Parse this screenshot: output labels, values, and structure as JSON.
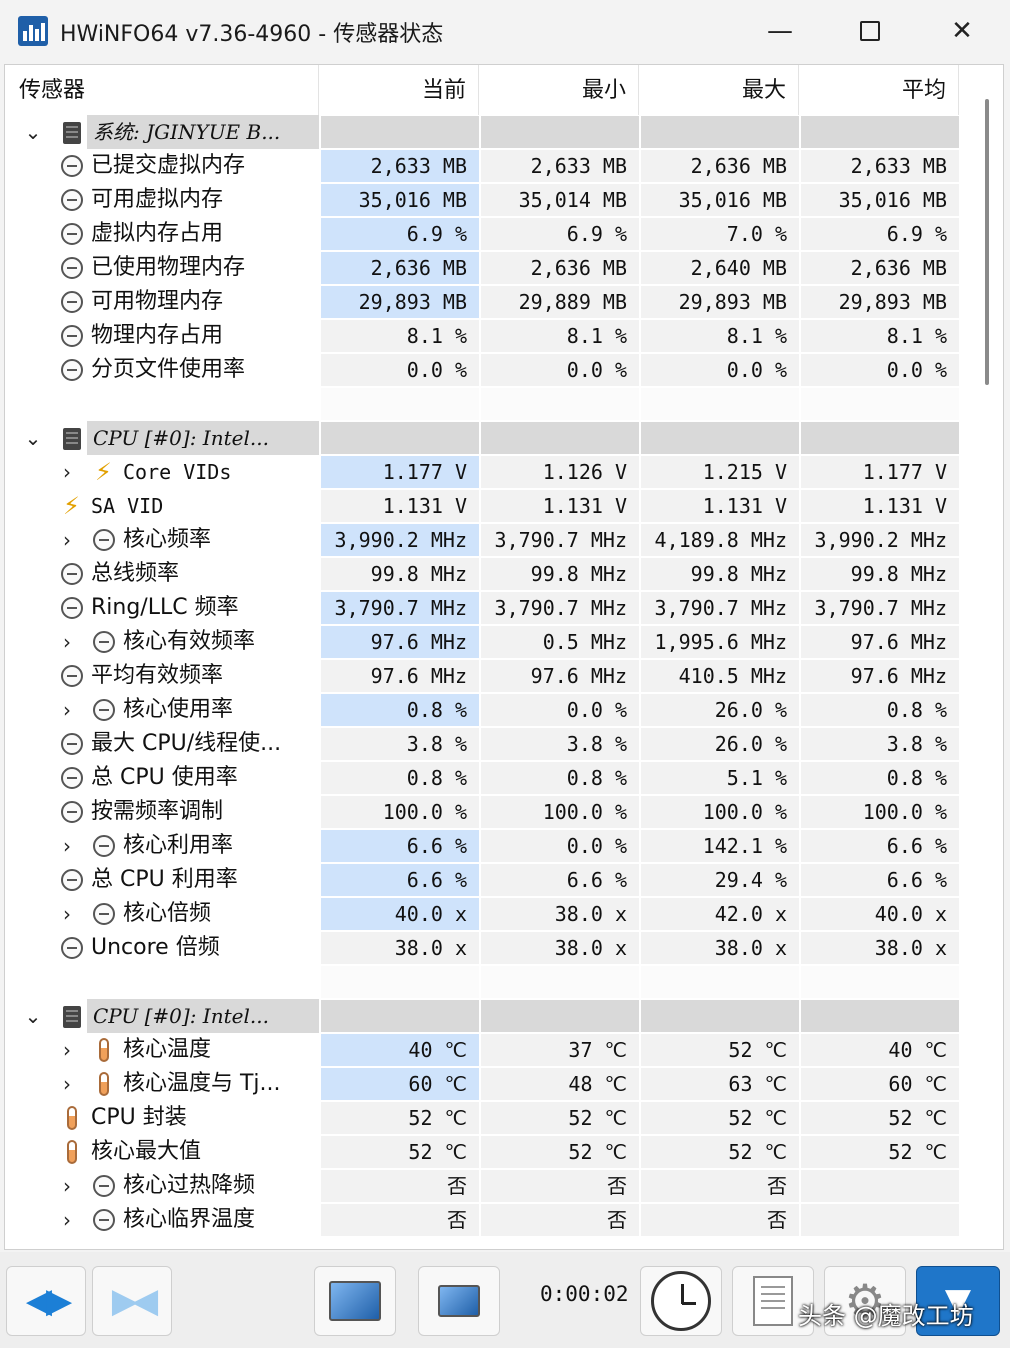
{
  "window": {
    "title": "HWiNFO64 v7.36-4960 - 传感器状态",
    "min_glyph": "—",
    "close_glyph": "✕"
  },
  "columns": {
    "sensor": "传感器",
    "current": "当前",
    "min": "最小",
    "max": "最大",
    "avg": "平均"
  },
  "rows": [
    {
      "type": "group",
      "label": "系统: JGINYUE B..."
    },
    {
      "type": "item",
      "label": "已提交虚拟内存",
      "icon": "clock-icon",
      "hl": true,
      "v": [
        "2,633 MB",
        "2,633 MB",
        "2,636 MB",
        "2,633 MB"
      ]
    },
    {
      "type": "item",
      "label": "可用虚拟内存",
      "icon": "clock-icon",
      "hl": true,
      "v": [
        "35,016 MB",
        "35,014 MB",
        "35,016 MB",
        "35,016 MB"
      ]
    },
    {
      "type": "item",
      "label": "虚拟内存占用",
      "icon": "clock-icon",
      "hl": true,
      "v": [
        "6.9 %",
        "6.9 %",
        "7.0 %",
        "6.9 %"
      ]
    },
    {
      "type": "item",
      "label": "已使用物理内存",
      "icon": "clock-icon",
      "hl": true,
      "v": [
        "2,636 MB",
        "2,636 MB",
        "2,640 MB",
        "2,636 MB"
      ]
    },
    {
      "type": "item",
      "label": "可用物理内存",
      "icon": "clock-icon",
      "hl": true,
      "v": [
        "29,893 MB",
        "29,889 MB",
        "29,893 MB",
        "29,893 MB"
      ]
    },
    {
      "type": "item",
      "label": "物理内存占用",
      "icon": "clock-icon",
      "hl": false,
      "v": [
        "8.1 %",
        "8.1 %",
        "8.1 %",
        "8.1 %"
      ]
    },
    {
      "type": "item",
      "label": "分页文件使用率",
      "icon": "clock-icon",
      "hl": false,
      "v": [
        "0.0 %",
        "0.0 %",
        "0.0 %",
        "0.0 %"
      ]
    },
    {
      "type": "spacer"
    },
    {
      "type": "group",
      "label": "CPU [#0]: Intel..."
    },
    {
      "type": "item",
      "label": "Core VIDs",
      "icon": "bolt-icon",
      "expand": true,
      "hl": true,
      "mono": true,
      "v": [
        "1.177 V",
        "1.126 V",
        "1.215 V",
        "1.177 V"
      ]
    },
    {
      "type": "item",
      "label": "SA VID",
      "icon": "bolt-icon",
      "hl": false,
      "mono": true,
      "v": [
        "1.131 V",
        "1.131 V",
        "1.131 V",
        "1.131 V"
      ]
    },
    {
      "type": "item",
      "label": "核心频率",
      "icon": "clock-icon",
      "expand": true,
      "hl": true,
      "v": [
        "3,990.2 MHz",
        "3,790.7 MHz",
        "4,189.8 MHz",
        "3,990.2 MHz"
      ]
    },
    {
      "type": "item",
      "label": "总线频率",
      "icon": "clock-icon",
      "hl": false,
      "v": [
        "99.8 MHz",
        "99.8 MHz",
        "99.8 MHz",
        "99.8 MHz"
      ]
    },
    {
      "type": "item",
      "label": "Ring/LLC 频率",
      "icon": "clock-icon",
      "hl": true,
      "v": [
        "3,790.7 MHz",
        "3,790.7 MHz",
        "3,790.7 MHz",
        "3,790.7 MHz"
      ]
    },
    {
      "type": "item",
      "label": "核心有效频率",
      "icon": "clock-icon",
      "expand": true,
      "hl": true,
      "v": [
        "97.6 MHz",
        "0.5 MHz",
        "1,995.6 MHz",
        "97.6 MHz"
      ]
    },
    {
      "type": "item",
      "label": "平均有效频率",
      "icon": "clock-icon",
      "hl": false,
      "v": [
        "97.6 MHz",
        "97.6 MHz",
        "410.5 MHz",
        "97.6 MHz"
      ]
    },
    {
      "type": "item",
      "label": "核心使用率",
      "icon": "clock-icon",
      "expand": true,
      "hl": true,
      "v": [
        "0.8 %",
        "0.0 %",
        "26.0 %",
        "0.8 %"
      ]
    },
    {
      "type": "item",
      "label": "最大 CPU/线程使...",
      "icon": "clock-icon",
      "hl": false,
      "v": [
        "3.8 %",
        "3.8 %",
        "26.0 %",
        "3.8 %"
      ]
    },
    {
      "type": "item",
      "label": "总 CPU 使用率",
      "icon": "clock-icon",
      "hl": false,
      "v": [
        "0.8 %",
        "0.8 %",
        "5.1 %",
        "0.8 %"
      ]
    },
    {
      "type": "item",
      "label": "按需频率调制",
      "icon": "clock-icon",
      "hl": false,
      "v": [
        "100.0 %",
        "100.0 %",
        "100.0 %",
        "100.0 %"
      ]
    },
    {
      "type": "item",
      "label": "核心利用率",
      "icon": "clock-icon",
      "expand": true,
      "hl": true,
      "v": [
        "6.6 %",
        "0.0 %",
        "142.1 %",
        "6.6 %"
      ]
    },
    {
      "type": "item",
      "label": "总 CPU 利用率",
      "icon": "clock-icon",
      "hl": true,
      "v": [
        "6.6 %",
        "6.6 %",
        "29.4 %",
        "6.6 %"
      ]
    },
    {
      "type": "item",
      "label": "核心倍频",
      "icon": "clock-icon",
      "expand": true,
      "hl": true,
      "v": [
        "40.0 x",
        "38.0 x",
        "42.0 x",
        "40.0 x"
      ]
    },
    {
      "type": "item",
      "label": "Uncore 倍频",
      "icon": "clock-icon",
      "hl": false,
      "v": [
        "38.0 x",
        "38.0 x",
        "38.0 x",
        "38.0 x"
      ]
    },
    {
      "type": "spacer"
    },
    {
      "type": "group",
      "label": "CPU [#0]: Intel..."
    },
    {
      "type": "item",
      "label": "核心温度",
      "icon": "thermometer-icon",
      "expand": true,
      "hl": true,
      "v": [
        "40 ℃",
        "37 ℃",
        "52 ℃",
        "40 ℃"
      ]
    },
    {
      "type": "item",
      "label": "核心温度与 Tj...",
      "icon": "thermometer-icon",
      "expand": true,
      "hl": true,
      "v": [
        "60 ℃",
        "48 ℃",
        "63 ℃",
        "60 ℃"
      ]
    },
    {
      "type": "item",
      "label": "CPU 封装",
      "icon": "thermometer-icon",
      "hl": false,
      "v": [
        "52 ℃",
        "52 ℃",
        "52 ℃",
        "52 ℃"
      ]
    },
    {
      "type": "item",
      "label": "核心最大值",
      "icon": "thermometer-icon",
      "hl": false,
      "v": [
        "52 ℃",
        "52 ℃",
        "52 ℃",
        "52 ℃"
      ]
    },
    {
      "type": "item",
      "label": "核心过热降频",
      "icon": "clock-icon",
      "expand": true,
      "hl": false,
      "v": [
        "否",
        "否",
        "否",
        ""
      ]
    },
    {
      "type": "item",
      "label": "核心临界温度",
      "icon": "clock-icon",
      "expand": true,
      "hl": false,
      "v": [
        "否",
        "否",
        "否",
        ""
      ]
    }
  ],
  "toolbar": {
    "timer": "0:00:02"
  },
  "watermark": "头条 @魔改工坊"
}
